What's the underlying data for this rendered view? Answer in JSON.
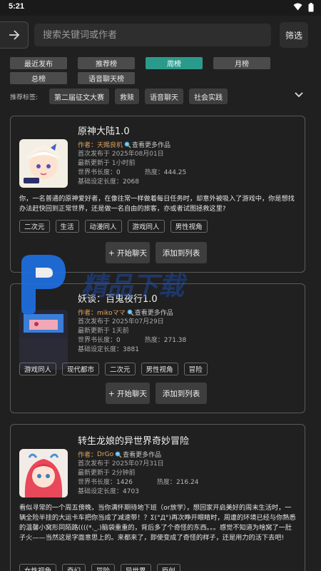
{
  "status_bar": {
    "time": "5:21"
  },
  "search": {
    "placeholder": "搜索关键词或作者",
    "filter_label": "筛选"
  },
  "tabs": [
    {
      "label": "最近发布",
      "active": false
    },
    {
      "label": "推荐榜",
      "active": false
    },
    {
      "label": "周榜",
      "active": true
    },
    {
      "label": "月榜",
      "active": false
    },
    {
      "label": "总榜",
      "active": false
    },
    {
      "label": "语音聊天榜",
      "active": false
    }
  ],
  "recommended_tags": {
    "label": "推荐标签:",
    "items": [
      "第二届征文大赛",
      "救赎",
      "语音聊天",
      "社会实践"
    ]
  },
  "cards": [
    {
      "title": "原神大陆1.0",
      "author_prefix": "作者：",
      "author": "天赐良机",
      "more_works": "查看更多作品",
      "first_published": "首次发布于 2025年08月01日",
      "last_updated": "最新更新于 1小时前",
      "world_book_length_label": "世界书长度：",
      "world_book_length": "0",
      "heat_label": "热度：",
      "heat": "444.25",
      "base_length_label": "基础设定长度：",
      "base_length": "2068",
      "description": "你，一名普通的原神爱好者，在像往常一样做着每日任务时，却意外被吸入了游戏中，你是想找办法赶快回到正常世界，还是做一名自由的旅客，亦或者试图拯救这里?",
      "tags": [
        "二次元",
        "生活",
        "动漫同人",
        "游戏同人",
        "男性视角"
      ],
      "start_chat": "+ 开始聊天",
      "add_to_list": "添加到列表"
    },
    {
      "title": "妖谈：百鬼夜行1.0",
      "author_prefix": "作者：",
      "author": "mikoママ",
      "more_works": "查看更多作品",
      "first_published": "首次发布于 2025年07月29日",
      "last_updated": "最新更新于 1天前",
      "world_book_length_label": "世界书长度：",
      "world_book_length": "0",
      "heat_label": "热度：",
      "heat": "271.38",
      "base_length_label": "基础设定长度：",
      "base_length": "3881",
      "description": "",
      "tags": [
        "游戏同人",
        "现代都市",
        "二次元",
        "男性视角",
        "冒险"
      ],
      "start_chat": "+ 开始聊天",
      "add_to_list": "添加到列表"
    },
    {
      "title": "转生龙娘的异世界奇妙冒险",
      "author_prefix": "作者：",
      "author": "DrGo",
      "more_works": "查看更多作品",
      "first_published": "首次发布于 2025年07月31日",
      "last_updated": "最新更新于 2分钟前",
      "world_book_length_label": "世界书长度：",
      "world_book_length": "1426",
      "heat_label": "热度：",
      "heat": "216.24",
      "base_length_label": "基础设定长度：",
      "base_length": "4703",
      "description": "看似寻常的一个周五傍晚，当你满怀期待地下班（or放学），想回家开启美好的周末生活时，一辆全险半挂的大运卡车把你当成了减速带！？Σ(°Д°)再次睁开眼睛时，周遭的环境已经与你熟悉的温馨小窝形同陌路((((*._.)脑袋重重的，背后多了个奇怪的东西。。。感觉不知道为啥窝了一肚子火——当然这是字面意思上的。来都来了，即使变成了奇怪的样子，还是用力的活下去吧!",
      "tags": [
        "女性视角",
        "奇幻",
        "冒险",
        "异世界",
        "原创"
      ],
      "start_chat": "",
      "add_to_list": ""
    }
  ],
  "watermark": {
    "text": "精品下载"
  },
  "colors": {
    "accent": "#2a9b8b",
    "author": "#e0a35a",
    "background": "#202020",
    "watermark": "#1e6fe0"
  }
}
